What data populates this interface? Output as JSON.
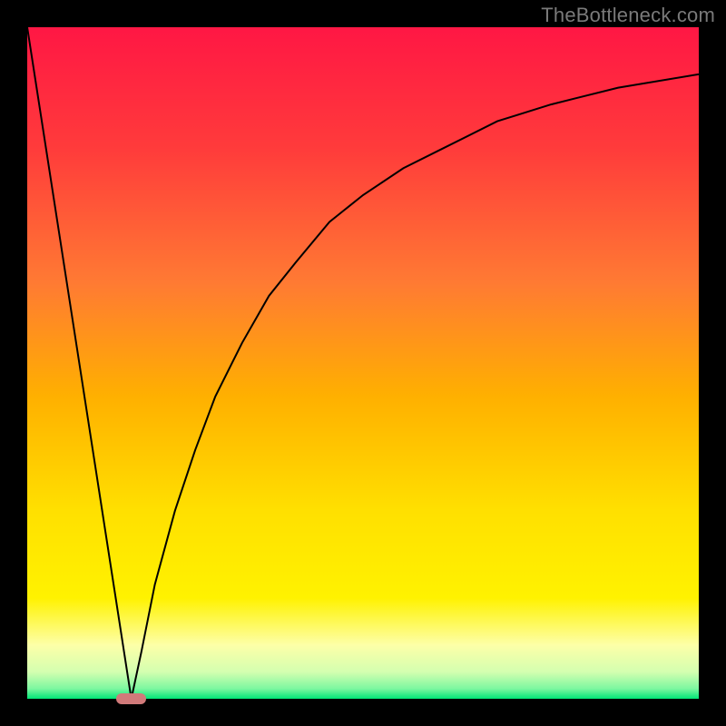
{
  "watermark": "TheBottleneck.com",
  "colors": {
    "frame": "#000000",
    "marker": "#d17a7a",
    "curve": "#000000",
    "gradient_stops": [
      {
        "offset": 0.0,
        "color": "#ff1744"
      },
      {
        "offset": 0.18,
        "color": "#ff3b3b"
      },
      {
        "offset": 0.38,
        "color": "#ff7a33"
      },
      {
        "offset": 0.55,
        "color": "#ffb000"
      },
      {
        "offset": 0.72,
        "color": "#ffe000"
      },
      {
        "offset": 0.85,
        "color": "#fff200"
      },
      {
        "offset": 0.92,
        "color": "#fdffa8"
      },
      {
        "offset": 0.96,
        "color": "#d4ffb0"
      },
      {
        "offset": 0.985,
        "color": "#7cf7a0"
      },
      {
        "offset": 1.0,
        "color": "#00e676"
      }
    ]
  },
  "chart_data": {
    "type": "line",
    "title": "",
    "xlabel": "",
    "ylabel": "",
    "xlim": [
      0,
      100
    ],
    "ylim": [
      0,
      100
    ],
    "grid": false,
    "legend": false,
    "series": [
      {
        "name": "left-slope",
        "x": [
          0.0,
          15.5
        ],
        "y": [
          100.0,
          0.0
        ]
      },
      {
        "name": "right-curve",
        "x": [
          15.5,
          17,
          19,
          22,
          25,
          28,
          32,
          36,
          40,
          45,
          50,
          56,
          62,
          70,
          78,
          88,
          100
        ],
        "y": [
          0.0,
          7,
          17,
          28,
          37,
          45,
          53,
          60,
          65,
          71,
          75,
          79,
          82,
          86,
          88.5,
          91,
          93
        ]
      }
    ],
    "annotations": [
      {
        "name": "minimum-marker",
        "x": 15.5,
        "y": 0,
        "w": 4.5,
        "h": 1.6
      }
    ]
  }
}
